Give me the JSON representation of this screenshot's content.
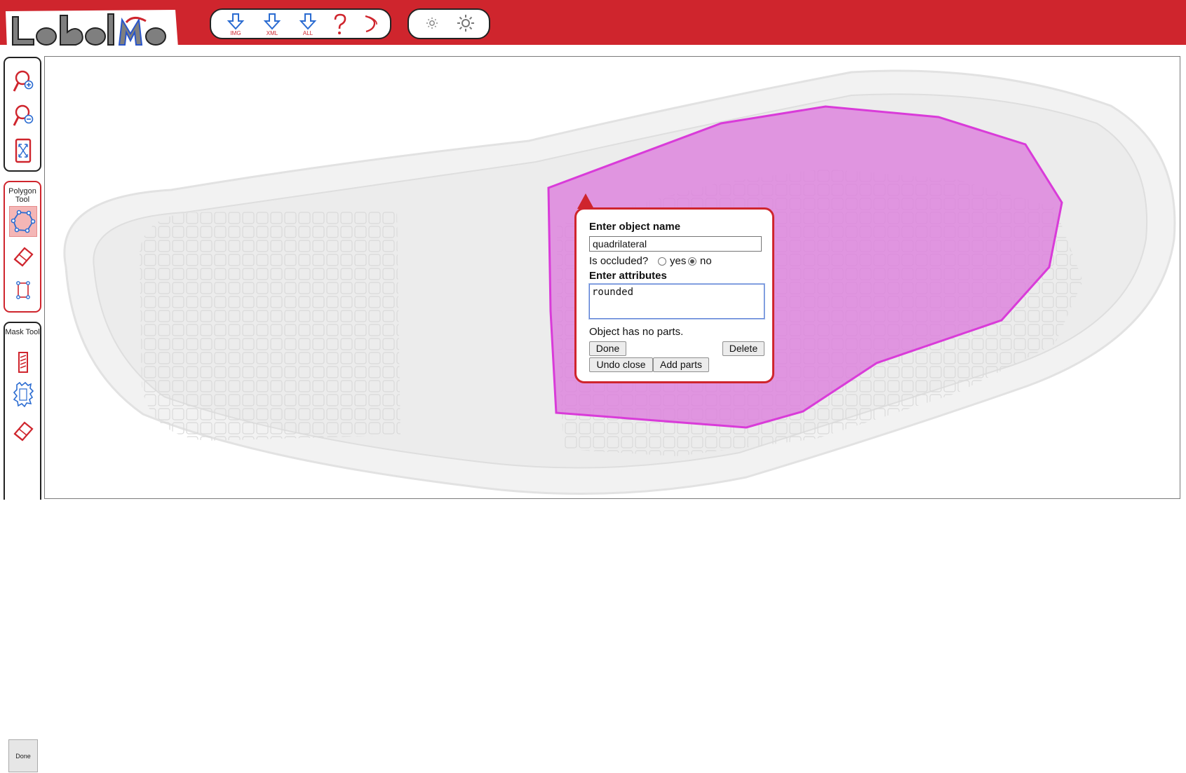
{
  "app": {
    "logo_text": "LabelMe",
    "brand_color": "#cf252d"
  },
  "toolbar": {
    "download_image_label": "IMG",
    "download_xml_label": "XML",
    "download_all_label": "ALL",
    "help_icon": "question-mark-icon",
    "erase_icon": "eraser-curve-icon",
    "brightness_down_icon": "sun-small-icon",
    "brightness_up_icon": "sun-large-icon"
  },
  "sidebar": {
    "polygon_title": "Polygon Tool",
    "mask_title": "Mask Tool",
    "done_label": "Done"
  },
  "popup": {
    "title": "Enter object name",
    "name_value": "quadrilateral",
    "occluded_label": "Is occluded?",
    "yes_label": "yes",
    "no_label": "no",
    "occluded_selected": "no",
    "attributes_title": "Enter attributes",
    "attributes_value": "rounded",
    "parts_text": "Object has no parts.",
    "done_label": "Done",
    "delete_label": "Delete",
    "undo_close_label": "Undo close",
    "add_parts_label": "Add parts"
  },
  "annotation": {
    "fill_color": "#dc78dc",
    "stroke_color": "#d93bd9"
  }
}
